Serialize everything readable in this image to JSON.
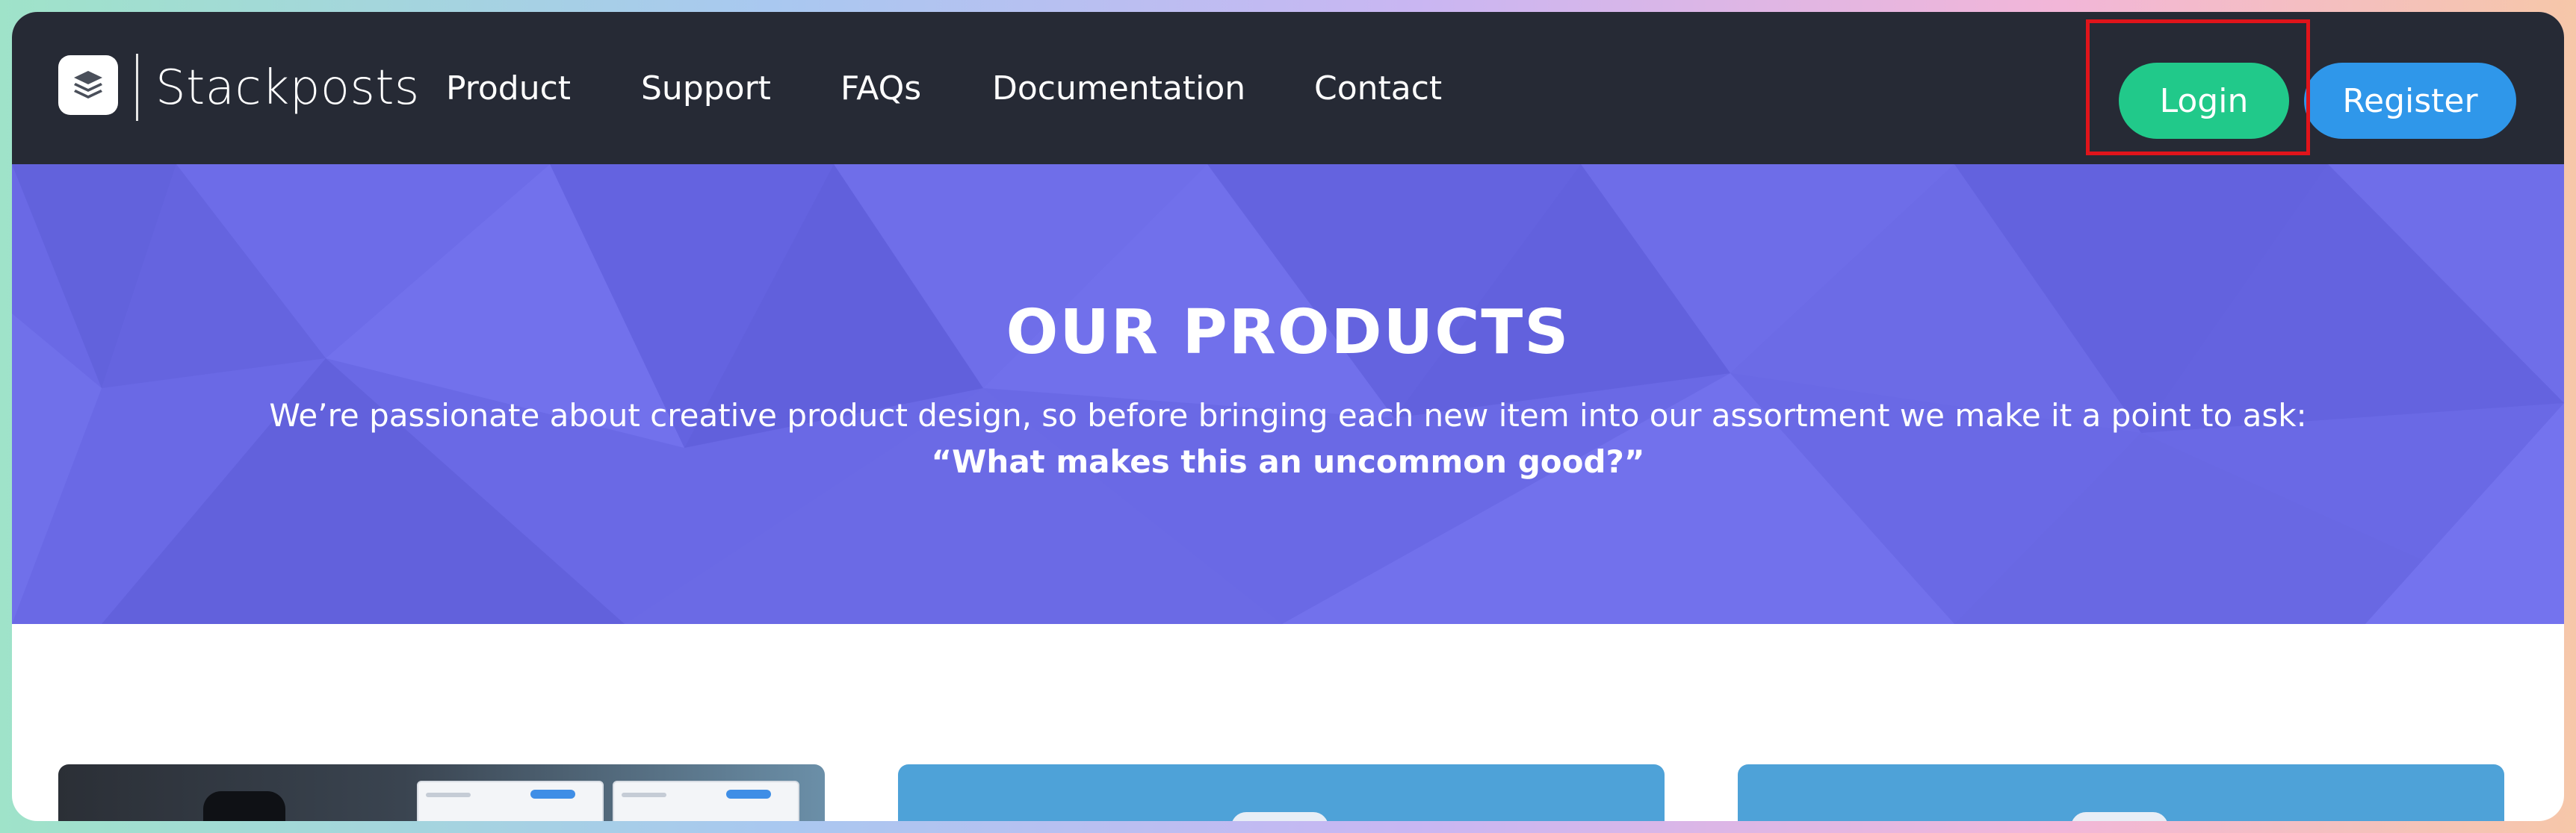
{
  "header": {
    "brand": "Stackposts",
    "nav": [
      "Product",
      "Support",
      "FAQs",
      "Documentation",
      "Contact"
    ],
    "login_label": "Login",
    "register_label": "Register"
  },
  "hero": {
    "title": "OUR PRODUCTS",
    "subtitle": "We’re passionate about creative product design, so before bringing each new item into our assortment we make it a point to ask:",
    "quote": "“What makes this an uncommon good?”"
  },
  "colors": {
    "header_bg": "#262a35",
    "hero_bg": "#6a69e5",
    "login": "#21c98a",
    "register": "#2f97ea",
    "highlight": "#e0141b"
  },
  "icons": {
    "logo": "layers-icon"
  }
}
